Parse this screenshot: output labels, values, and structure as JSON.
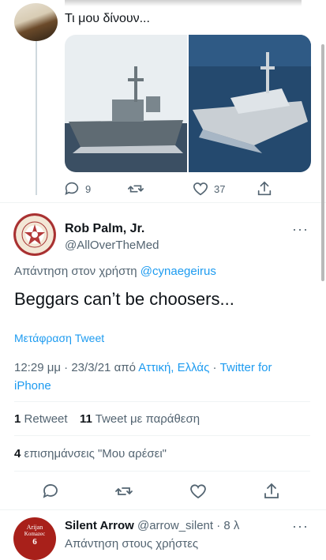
{
  "previous_tweet": {
    "text": "Τι μου δίνουν...",
    "actions": {
      "reply_count": "9",
      "like_count": "37"
    }
  },
  "main_tweet": {
    "display_name": "Rob Palm, Jr.",
    "handle": "@AllOverTheMed",
    "reply_prefix": "Απάντηση στον χρήστη",
    "reply_to": "@cynaegeirus",
    "body": "Beggars can’t be choosers...",
    "translate": "Μετάφραση Tweet",
    "time": "12:29 μμ",
    "date": "23/3/21",
    "from_word": "από",
    "location": "Αττική, Ελλάς",
    "source": "Twitter for iPhone",
    "stats": {
      "retweets_count": "1",
      "retweets_label": "Retweet",
      "quotes_count": "11",
      "quotes_label": "Tweet με παράθεση",
      "likes_count": "4",
      "likes_label": "επισημάνσεις \"Μου αρέσει\""
    }
  },
  "next_reply": {
    "display_name": "Silent Arrow",
    "handle": "@arrow_silent",
    "age": "8 λ",
    "text": "Απάντηση στους χρήστες",
    "avatar_text_1": "Arijan",
    "avatar_text_2": "Komazec",
    "avatar_text_3": "6"
  },
  "colors": {
    "accent": "#1d9bf0",
    "muted": "#536471",
    "divider": "#eff3f4"
  }
}
